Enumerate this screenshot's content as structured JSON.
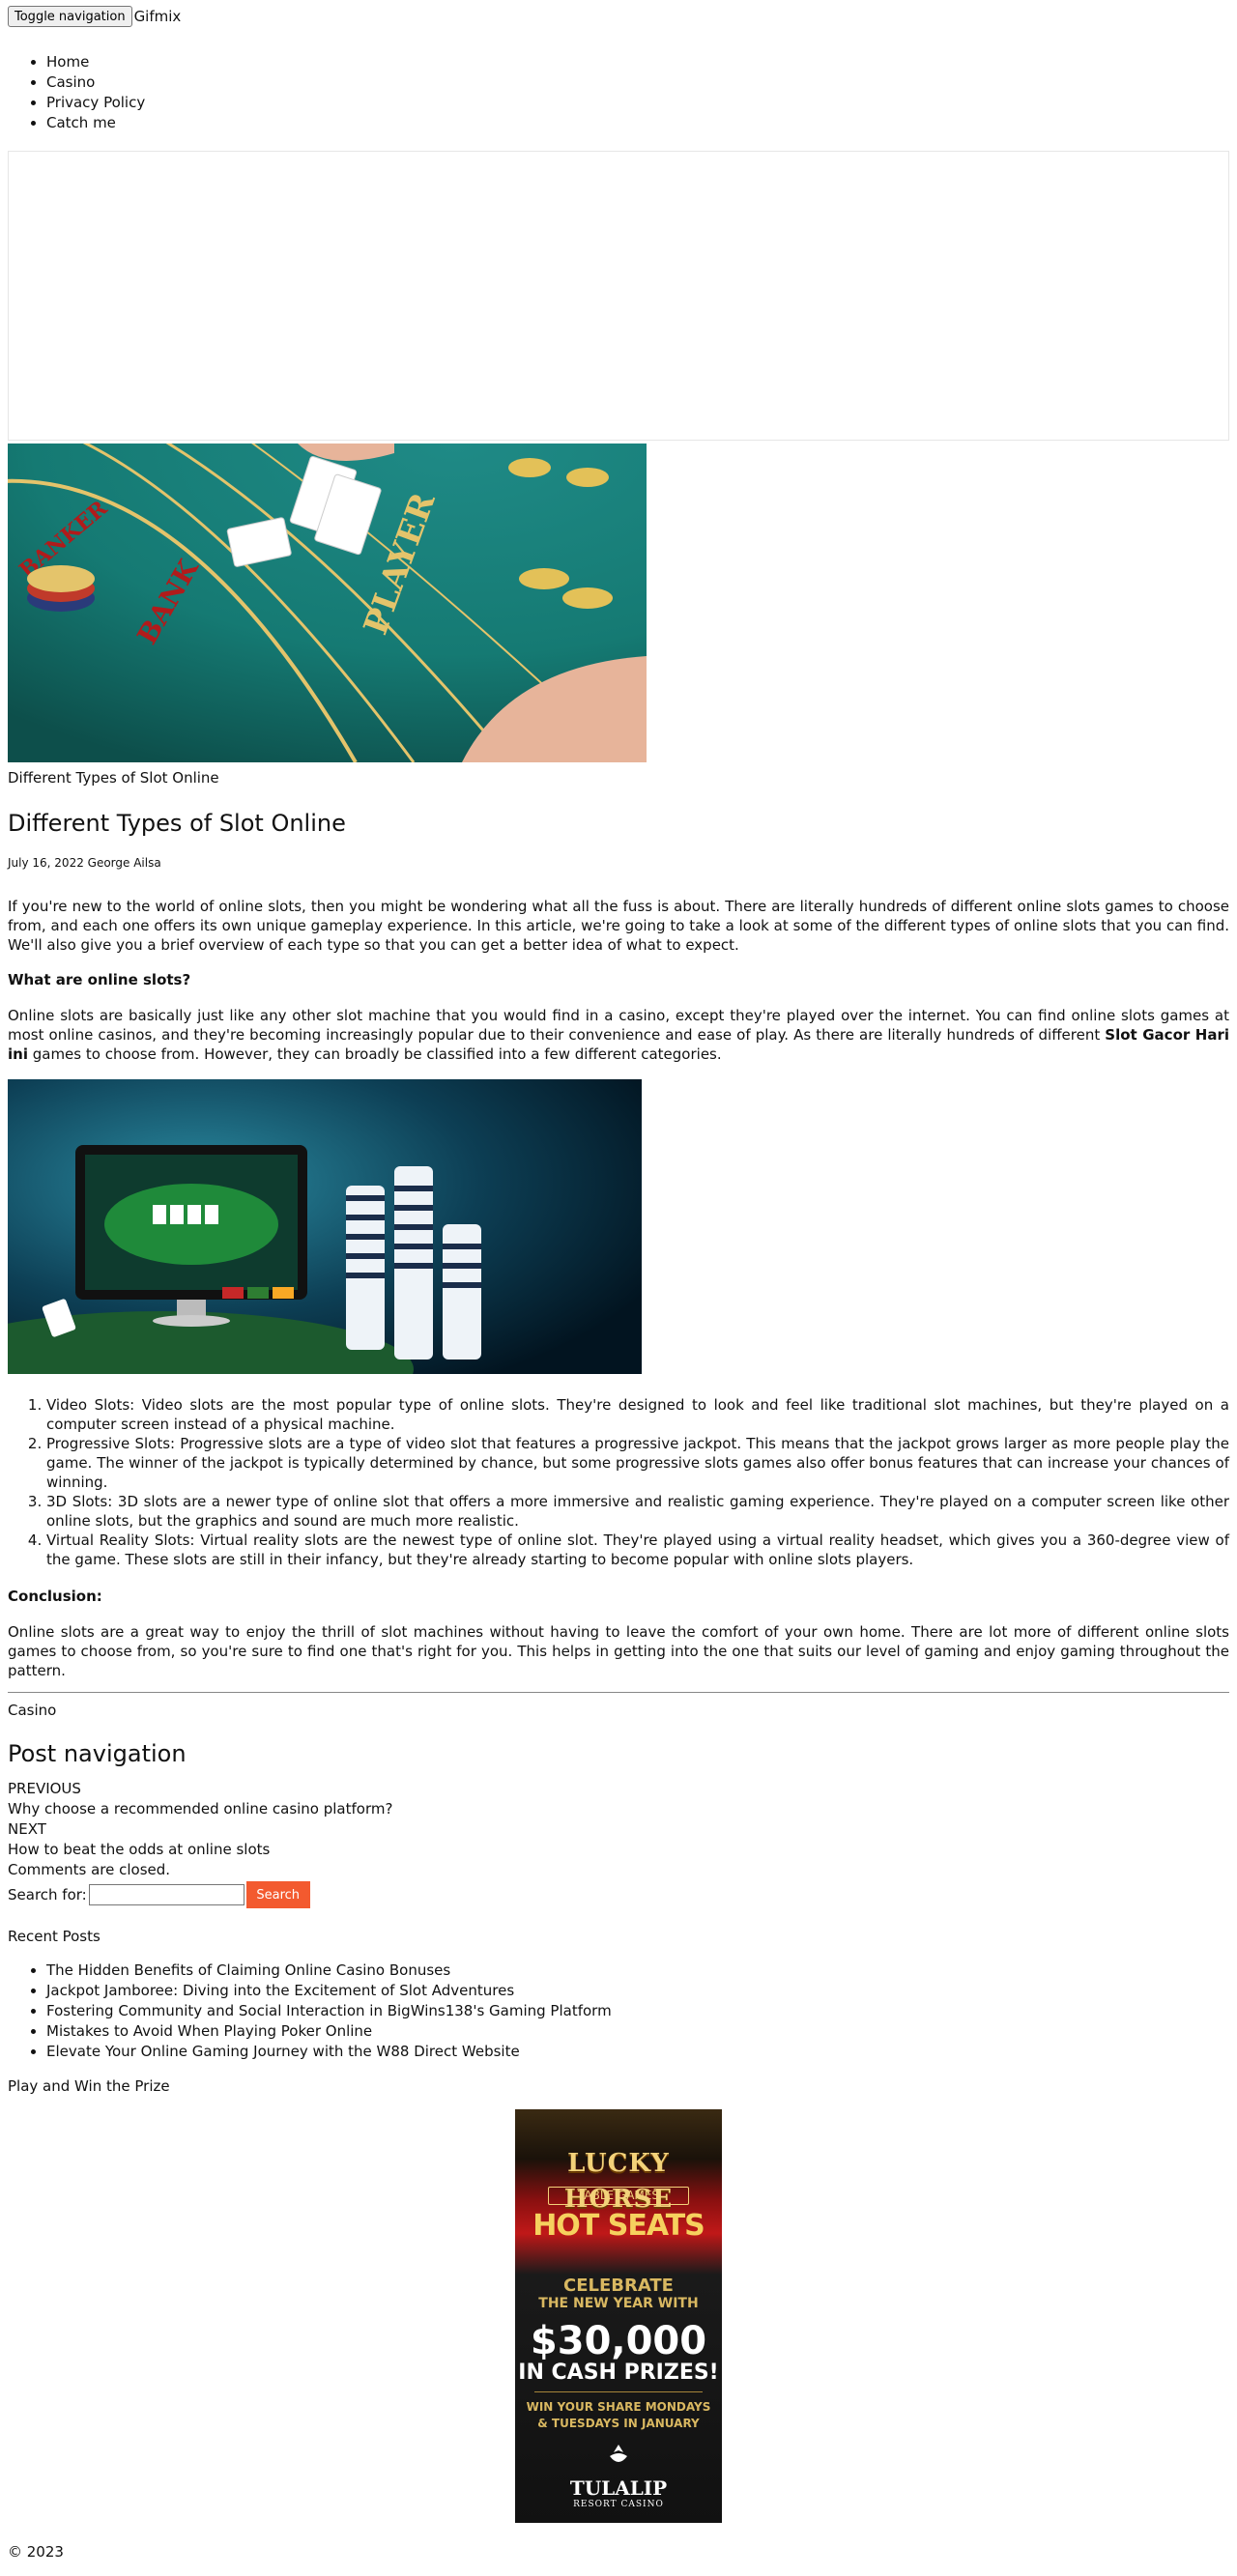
{
  "nav": {
    "toggle_label": "Toggle navigation",
    "brand": "Gifmix",
    "items": [
      {
        "label": "Home"
      },
      {
        "label": "Casino"
      },
      {
        "label": "Privacy Policy"
      },
      {
        "label": "Catch me"
      }
    ]
  },
  "featured": {
    "caption": "Different Types of Slot Online"
  },
  "article": {
    "title": "Different Types of Slot Online",
    "meta": "July 16, 2022 George Ailsa",
    "intro": "If you're new to the world of online slots, then you might be wondering what all the fuss is about. There are literally hundreds of different online slots games to choose from, and each one offers its own unique gameplay experience. In this article, we're going to take a look at some of the different types of online slots that you can find. We'll also give you a brief overview of each type so that you can get a better idea of what to expect.",
    "q_heading": "What are online slots?",
    "q_body_pre": "Online slots are basically just like any other slot machine that you would find in a casino, except they're played over the internet. You can find online slots games at most online casinos, and they're becoming increasingly popular due to their convenience and ease of play. As there are literally hundreds of different ",
    "q_body_link": "Slot Gacor Hari ini",
    "q_body_post": " games to choose from. However, they can broadly be classified into a few different categories.",
    "types": [
      {
        "text": "Video Slots: Video slots are the most popular type of online slots. They're designed to look and feel like traditional slot machines, but they're played on a computer screen instead of a physical machine."
      },
      {
        "text": "Progressive Slots: Progressive slots are a type of video slot that features a progressive jackpot. This means that the jackpot grows larger as more people play the game. The winner of the jackpot is typically determined by chance, but some progressive slots games also offer bonus features that can increase your chances of winning."
      },
      {
        "text": "3D Slots: 3D slots are a newer type of online slot that offers a more immersive and realistic gaming experience. They're played on a computer screen like other online slots, but the graphics and sound are much more realistic."
      },
      {
        "text": "Virtual Reality Slots: Virtual reality slots are the newest type of online slot. They're played using a virtual reality headset, which gives you a 360-degree view of the game. These slots are still in their infancy, but they're already starting to become popular with online slots players."
      }
    ],
    "conclusion_heading": "Conclusion:",
    "conclusion_body": "Online slots are a great way to enjoy the thrill of slot machines without having to leave the comfort of your own home. There are lot more of different online slots games to choose from, so you're sure to find one that's right for you. This helps in getting into the one that suits our level of gaming and enjoy gaming throughout the pattern.",
    "category": "Casino"
  },
  "post_nav": {
    "title": "Post navigation",
    "prev_label": "PREVIOUS",
    "prev_title": "Why choose a recommended online casino platform?",
    "next_label": "NEXT",
    "next_title": "How to beat the odds at online slots",
    "comments_closed": "Comments are closed."
  },
  "search": {
    "label": "Search for:",
    "placeholder": "",
    "value": "",
    "button_label": "Search",
    "button_color": "#f35a2f"
  },
  "recent": {
    "title": "Recent Posts",
    "items": [
      {
        "label": "The Hidden Benefits of Claiming Online Casino Bonuses"
      },
      {
        "label": "Jackpot Jamboree: Diving into the Excitement of Slot Adventures"
      },
      {
        "label": "Fostering Community and Social Interaction in BigWins138's Gaming Platform"
      },
      {
        "label": "Mistakes to Avoid When Playing Poker Online"
      },
      {
        "label": "Elevate Your Online Gaming Journey with the W88 Direct Website"
      }
    ]
  },
  "promo": {
    "title": "Play and Win the Prize",
    "banner": {
      "line1": "LUCKY HORSE",
      "line2": "TABLE GAMES",
      "line3": "HOT SEATS",
      "line4": "CELEBRATE",
      "line5": "THE NEW YEAR WITH",
      "line6": "$30,000",
      "line7": "IN CASH PRIZES!",
      "line8": "WIN YOUR SHARE MONDAYS",
      "line9": "& TUESDAYS IN JANUARY",
      "line10": "TULALIP",
      "line11": "RESORT CASINO"
    }
  },
  "footer": {
    "copyright": "© 2023"
  }
}
